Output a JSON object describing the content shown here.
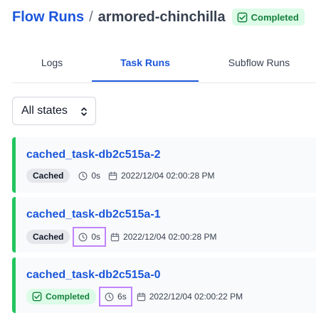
{
  "breadcrumb": {
    "parent": "Flow Runs",
    "separator": "/",
    "current": "armored-chinchilla",
    "state": "Completed"
  },
  "tabs": [
    {
      "label": "Logs",
      "active": false
    },
    {
      "label": "Task Runs",
      "active": true
    },
    {
      "label": "Subflow Runs",
      "active": false
    }
  ],
  "filter": {
    "selected": "All states"
  },
  "task_runs": [
    {
      "name": "cached_task-db2c515a-2",
      "state": "Cached",
      "duration": "0s",
      "timestamp": "2022/12/04 02:00:28 PM"
    },
    {
      "name": "cached_task-db2c515a-1",
      "state": "Cached",
      "duration": "0s",
      "timestamp": "2022/12/04 02:00:28 PM"
    },
    {
      "name": "cached_task-db2c515a-0",
      "state": "Completed",
      "duration": "6s",
      "timestamp": "2022/12/04 02:00:22 PM"
    }
  ],
  "colors": {
    "accent": "#1a56db",
    "completed_bg": "#dcfce7",
    "completed_text": "#15803d",
    "card_border": "#22c55e",
    "highlight": "#c084fc"
  }
}
